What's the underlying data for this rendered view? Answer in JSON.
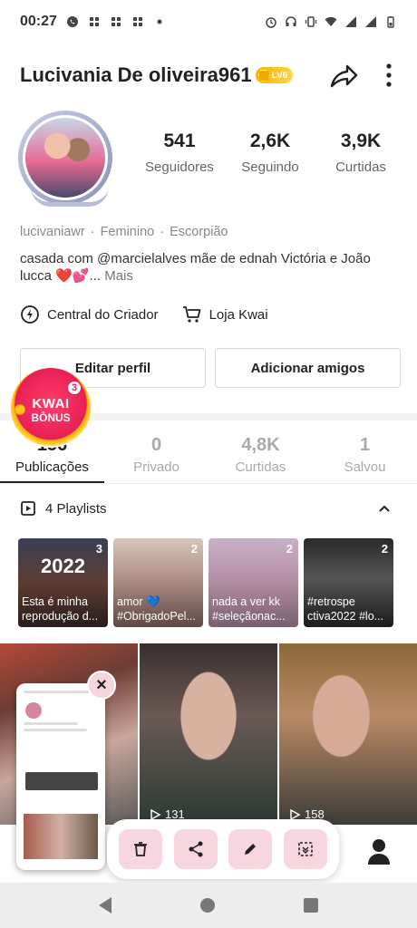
{
  "status_bar": {
    "time": "00:27",
    "left_icons": [
      "whatsapp-icon",
      "app-notification-icon",
      "app-notification-icon",
      "app-notification-icon",
      "dot-icon"
    ],
    "right_icons": [
      "alarm-icon",
      "headset-icon",
      "vibrate-icon",
      "wifi-icon",
      "signal-icon",
      "signal-icon",
      "battery-icon"
    ]
  },
  "header": {
    "username": "Lucivania De oliveira961",
    "level_badge": "LV6"
  },
  "profile": {
    "stats": [
      {
        "value": "541",
        "label": "Seguidores"
      },
      {
        "value": "2,6K",
        "label": "Seguindo"
      },
      {
        "value": "3,9K",
        "label": "Curtidas"
      }
    ],
    "meta": {
      "handle": "lucivaniawr",
      "gender": "Feminino",
      "sign": "Escorpião"
    },
    "bio_line1": "casada com @marcielalves mãe de  ednah Victória e João",
    "bio_line2_text": "lucca",
    "bio_hearts": [
      "❤️",
      "💕"
    ],
    "bio_ellipsis": "...",
    "bio_more": "Mais"
  },
  "tools": {
    "creator_center": "Central do Criador",
    "shop": "Loja Kwai"
  },
  "buttons": {
    "edit_profile": "Editar perfil",
    "add_friends": "Adicionar amigos"
  },
  "kwai_bonus": {
    "line1": "KWAI",
    "line2": "BÔNUS",
    "badge": "3"
  },
  "tabs": [
    {
      "count": "156",
      "label": "Publicações",
      "active": true
    },
    {
      "count": "0",
      "label": "Privado",
      "active": false
    },
    {
      "count": "4,8K",
      "label": "Curtidas",
      "active": false
    },
    {
      "count": "1",
      "label": "Salvou",
      "active": false
    }
  ],
  "playlists_header": "4 Playlists",
  "playlists": [
    {
      "count": "3",
      "overlay_text": "2022",
      "caption": "Esta é minha reprodução d..."
    },
    {
      "count": "2",
      "caption": "amor 💙 #ObrigadoPel..."
    },
    {
      "count": "2",
      "caption": "nada a ver kk #seleçãonac..."
    },
    {
      "count": "2",
      "caption": "#retrospe ctiva2022 #lo..."
    }
  ],
  "videos": [
    {
      "views": ""
    },
    {
      "views": "131"
    },
    {
      "views": "158"
    }
  ],
  "screenshot_overlay": {
    "close": "×",
    "actions": [
      "delete-icon",
      "share-icon",
      "edit-icon",
      "long-screenshot-icon"
    ]
  },
  "colors": {
    "accent_pink": "#f8d6df",
    "kwai_red": "#e81f55",
    "badge_gold": "#f5b400"
  }
}
